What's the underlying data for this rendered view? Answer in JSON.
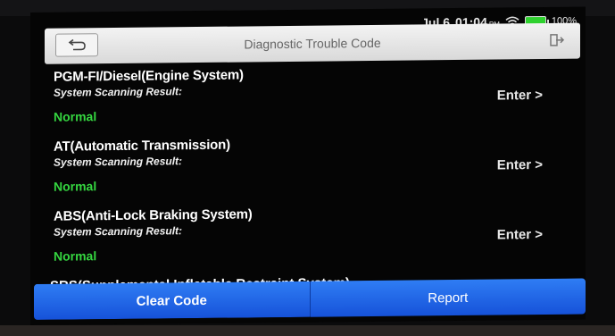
{
  "status_bar": {
    "date": "Jul 6",
    "time": "01:04",
    "ampm": "PM",
    "battery": "100%"
  },
  "header": {
    "title": "Diagnostic Trouble Code"
  },
  "systems": [
    {
      "name": "PGM-FI/Diesel(Engine System)",
      "label": "System Scanning Result:",
      "status": "Normal",
      "action": "Enter >"
    },
    {
      "name": "AT(Automatic Transmission)",
      "label": "System Scanning Result:",
      "status": "Normal",
      "action": "Enter >"
    },
    {
      "name": "ABS(Anti-Lock Braking System)",
      "label": "System Scanning Result:",
      "status": "Normal",
      "action": "Enter >"
    },
    {
      "name": "SRS(Supplemental Inflatable Restraint System)"
    }
  ],
  "footer": {
    "clear_label": "Clear Code",
    "report_label": "Report"
  },
  "colors": {
    "accent": "#1e63e6",
    "status_normal": "#35d640"
  }
}
